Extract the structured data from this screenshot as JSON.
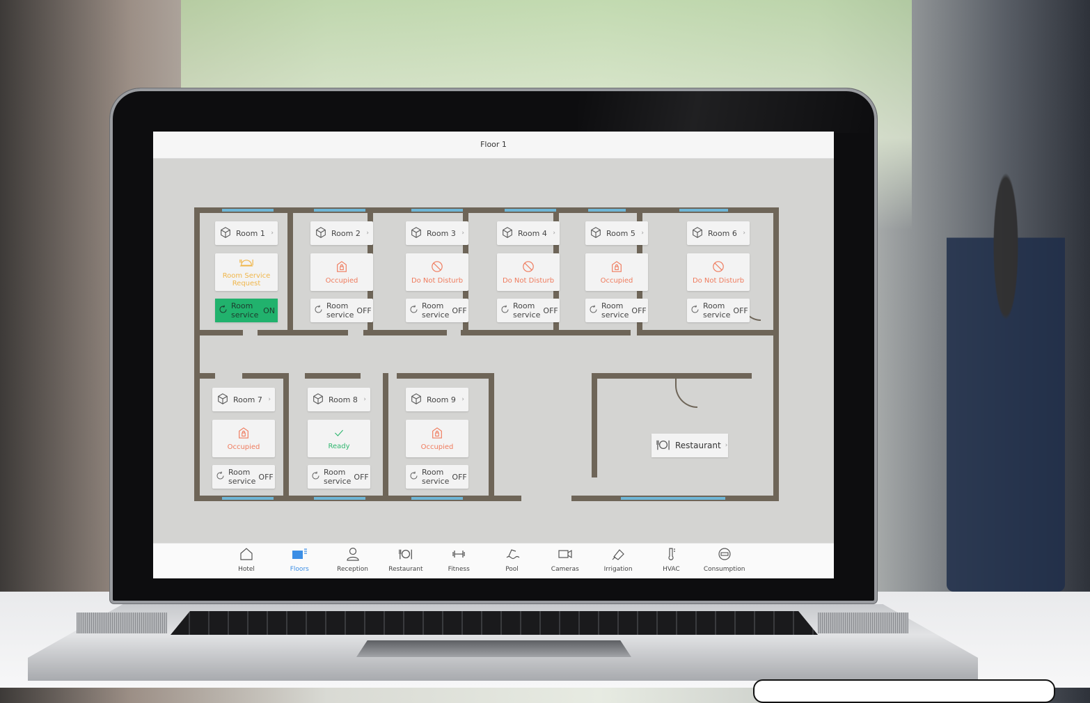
{
  "header": {
    "title": "Floor 1"
  },
  "rooms": [
    {
      "name": "Room 1",
      "status": "Room Service Request",
      "status_color": "#f0b64a",
      "service_label": "Room service",
      "service_state": "ON",
      "icon": "room-service-icon"
    },
    {
      "name": "Room 2",
      "status": "Occupied",
      "status_color": "#ef7b5d",
      "service_label": "Room service",
      "service_state": "OFF",
      "icon": "occupied-icon"
    },
    {
      "name": "Room 3",
      "status": "Do Not Disturb",
      "status_color": "#ef7b5d",
      "service_label": "Room service",
      "service_state": "OFF",
      "icon": "do-not-disturb-icon"
    },
    {
      "name": "Room 4",
      "status": "Do Not Disturb",
      "status_color": "#ef7b5d",
      "service_label": "Room service",
      "service_state": "OFF",
      "icon": "do-not-disturb-icon"
    },
    {
      "name": "Room 5",
      "status": "Occupied",
      "status_color": "#ef7b5d",
      "service_label": "Room service",
      "service_state": "OFF",
      "icon": "occupied-icon"
    },
    {
      "name": "Room 6",
      "status": "Do Not Disturb",
      "status_color": "#ef7b5d",
      "service_label": "Room service",
      "service_state": "OFF",
      "icon": "do-not-disturb-icon"
    },
    {
      "name": "Room 7",
      "status": "Occupied",
      "status_color": "#ef7b5d",
      "service_label": "Room service",
      "service_state": "OFF",
      "icon": "occupied-icon"
    },
    {
      "name": "Room 8",
      "status": "Ready",
      "status_color": "#2fb66f",
      "service_label": "Room service",
      "service_state": "OFF",
      "icon": "ready-check-icon"
    },
    {
      "name": "Room 9",
      "status": "Occupied",
      "status_color": "#ef7b5d",
      "service_label": "Room service",
      "service_state": "OFF",
      "icon": "occupied-icon"
    }
  ],
  "restaurant": {
    "label": "Restaurant",
    "icon": "restaurant-icon"
  },
  "nav": [
    {
      "label": "Hotel",
      "icon": "home-icon",
      "active": false
    },
    {
      "label": "Floors",
      "icon": "floors-icon",
      "active": true
    },
    {
      "label": "Reception",
      "icon": "person-icon",
      "active": false
    },
    {
      "label": "Restaurant",
      "icon": "restaurant-icon",
      "active": false
    },
    {
      "label": "Fitness",
      "icon": "dumbbell-icon",
      "active": false
    },
    {
      "label": "Pool",
      "icon": "pool-icon",
      "active": false
    },
    {
      "label": "Cameras",
      "icon": "camera-icon",
      "active": false
    },
    {
      "label": "Irrigation",
      "icon": "irrigation-icon",
      "active": false
    },
    {
      "label": "HVAC",
      "icon": "thermometer-icon",
      "active": false
    },
    {
      "label": "Consumption",
      "icon": "meter-icon",
      "active": false
    }
  ],
  "colors": {
    "accent": "#3b8ee5",
    "service_on": "#21b26d",
    "wall": "#6e6558",
    "window": "#6fb6d6"
  }
}
